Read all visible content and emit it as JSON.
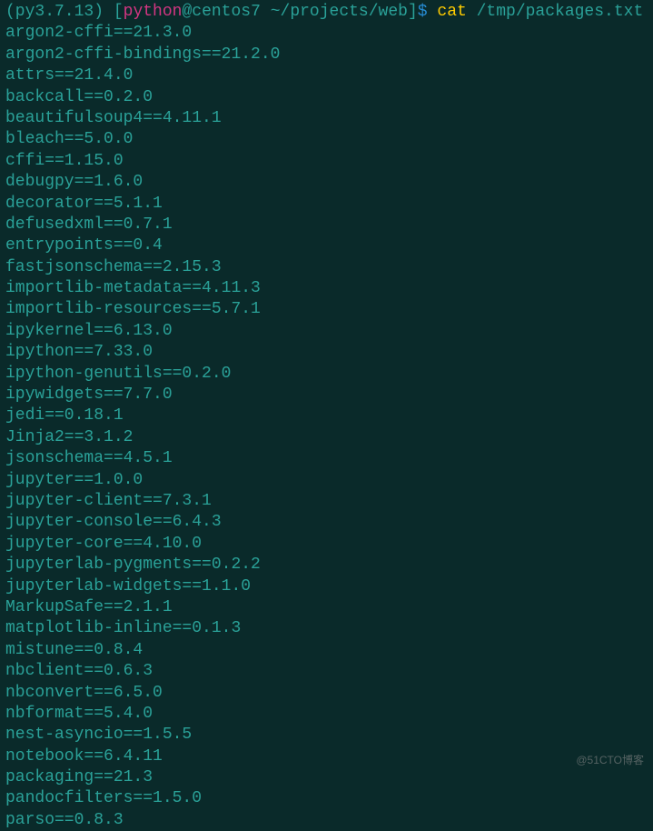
{
  "prompt": {
    "venv": "(py3.7.13)",
    "user": "python",
    "at": "@",
    "host": "centos7",
    "path": "~/projects/web",
    "dollar": "$",
    "command": "cat",
    "arg": "/tmp/packages.txt"
  },
  "output_lines": [
    "argon2-cffi==21.3.0",
    "argon2-cffi-bindings==21.2.0",
    "attrs==21.4.0",
    "backcall==0.2.0",
    "beautifulsoup4==4.11.1",
    "bleach==5.0.0",
    "cffi==1.15.0",
    "debugpy==1.6.0",
    "decorator==5.1.1",
    "defusedxml==0.7.1",
    "entrypoints==0.4",
    "fastjsonschema==2.15.3",
    "importlib-metadata==4.11.3",
    "importlib-resources==5.7.1",
    "ipykernel==6.13.0",
    "ipython==7.33.0",
    "ipython-genutils==0.2.0",
    "ipywidgets==7.7.0",
    "jedi==0.18.1",
    "Jinja2==3.1.2",
    "jsonschema==4.5.1",
    "jupyter==1.0.0",
    "jupyter-client==7.3.1",
    "jupyter-console==6.4.3",
    "jupyter-core==4.10.0",
    "jupyterlab-pygments==0.2.2",
    "jupyterlab-widgets==1.1.0",
    "MarkupSafe==2.1.1",
    "matplotlib-inline==0.1.3",
    "mistune==0.8.4",
    "nbclient==0.6.3",
    "nbconvert==6.5.0",
    "nbformat==5.4.0",
    "nest-asyncio==1.5.5",
    "notebook==6.4.11",
    "packaging==21.3",
    "pandocfilters==1.5.0",
    "parso==0.8.3"
  ],
  "watermark": "@51CTO博客"
}
